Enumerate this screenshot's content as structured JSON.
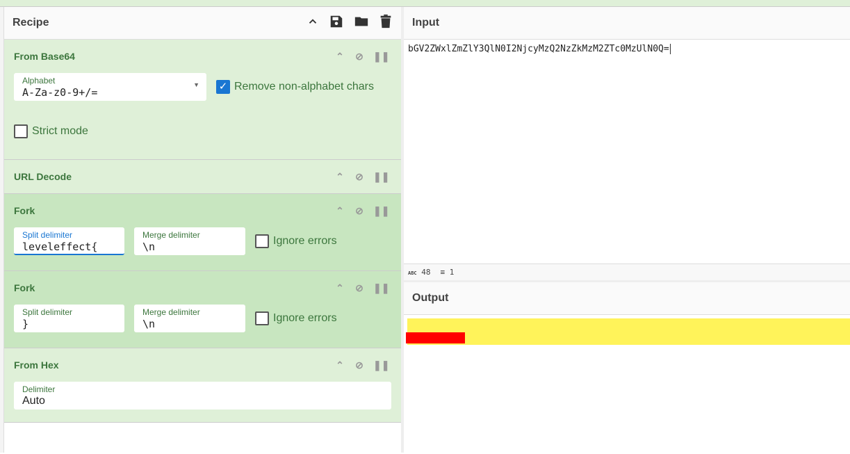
{
  "recipe": {
    "title": "Recipe",
    "icons": [
      "chevron-up-icon",
      "save-icon",
      "folder-icon",
      "trash-icon"
    ],
    "operations": [
      {
        "name": "From Base64",
        "fields": [
          {
            "label": "Alphabet",
            "value": "A-Za-z0-9+/="
          }
        ],
        "checkboxes": [
          {
            "label": "Remove non-alphabet chars",
            "checked": true
          },
          {
            "label": "Strict mode",
            "checked": false
          }
        ]
      },
      {
        "name": "URL Decode"
      },
      {
        "name": "Fork",
        "fields": [
          {
            "label": "Split delimiter",
            "value": "leveleffect{"
          },
          {
            "label": "Merge delimiter",
            "value": "\\n"
          }
        ],
        "checkboxes": [
          {
            "label": "Ignore errors",
            "checked": false
          }
        ]
      },
      {
        "name": "Fork",
        "fields": [
          {
            "label": "Split delimiter",
            "value": "}"
          },
          {
            "label": "Merge delimiter",
            "value": "\\n"
          }
        ],
        "checkboxes": [
          {
            "label": "Ignore errors",
            "checked": false
          }
        ]
      },
      {
        "name": "From Hex",
        "fields": [
          {
            "label": "Delimiter",
            "value": "Auto"
          }
        ]
      }
    ]
  },
  "input": {
    "title": "Input",
    "value": "bGV2ZWxlZmZlY3QlN0I2NjcyMzQ2NzZkMzM2ZTc0MzUlN0Q=",
    "length": "48",
    "lines": "1"
  },
  "output": {
    "title": "Output",
    "highlight_color": "#fff35a",
    "redaction_color": "#ff0000"
  }
}
